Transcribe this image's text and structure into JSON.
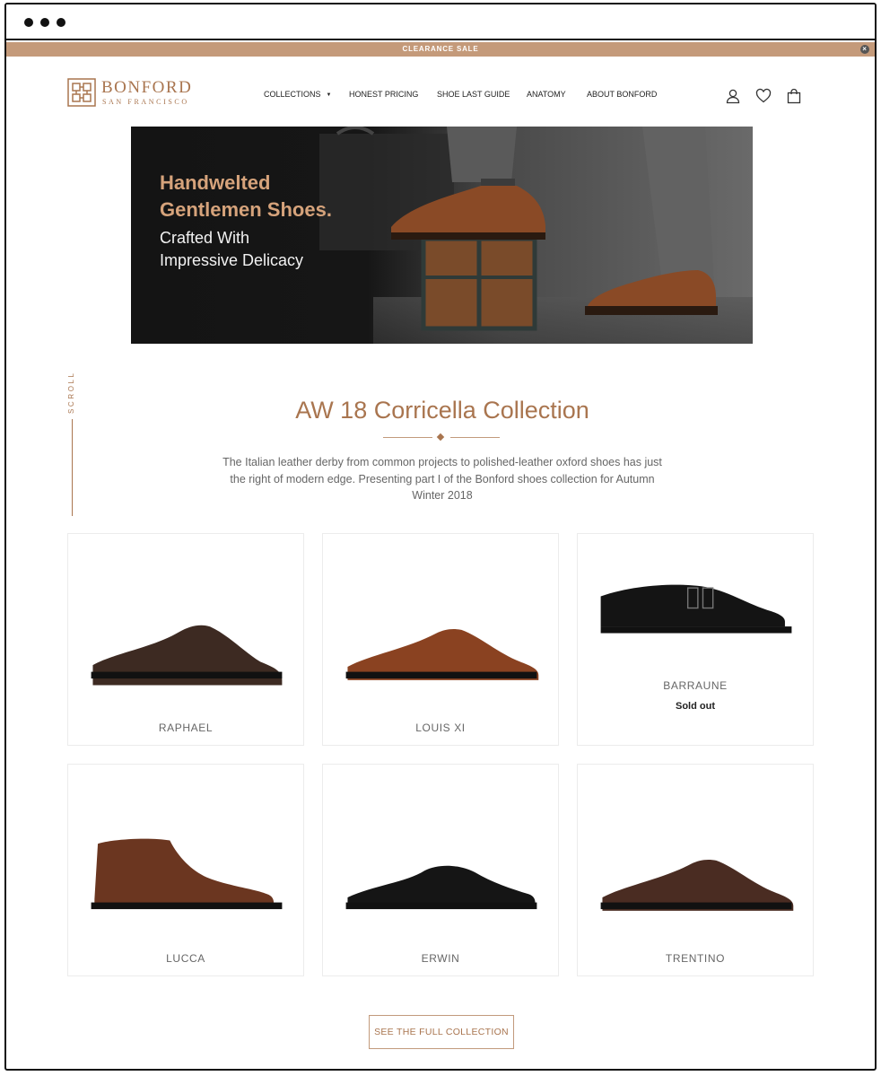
{
  "promo_bar": {
    "text": "CLEARANCE SALE",
    "close_icon": "close-icon"
  },
  "brand": {
    "name": "BONFORD",
    "subtitle": "SAN FRANCISCO",
    "accent_color": "#a9754f"
  },
  "nav": {
    "items": [
      {
        "label": "COLLECTIONS",
        "has_dropdown": true
      },
      {
        "label": "HONEST PRICING"
      },
      {
        "label": "SHOE LAST GUIDE"
      },
      {
        "label": "ANATOMY"
      },
      {
        "label": "ABOUT BONFORD"
      }
    ],
    "icons": [
      "user-icon",
      "heart-icon",
      "shopping-bag-icon"
    ]
  },
  "hero": {
    "headline_line1": "Handwelted",
    "headline_line2": "Gentlemen Shoes.",
    "sub_line1": "Crafted With",
    "sub_line2": "Impressive Delicacy"
  },
  "scroll_label": "SCROLL",
  "collection": {
    "title": "AW 18 Corricella Collection",
    "description": "The Italian leather derby from common projects to polished-leather oxford shoes has just the right of modern edge. Presenting part I of the Bonford shoes collection for Autumn Winter 2018",
    "products": [
      {
        "name": "RAPHAEL",
        "status": "",
        "color": "#3d2a22",
        "style": "brogue"
      },
      {
        "name": "LOUIS XI",
        "status": "",
        "color": "#8a4221",
        "style": "wholecut"
      },
      {
        "name": "BARRAUNE",
        "status": "Sold out",
        "color": "#141414",
        "style": "monk"
      },
      {
        "name": "LUCCA",
        "status": "",
        "color": "#6b3620",
        "style": "chukka"
      },
      {
        "name": "ERWIN",
        "status": "",
        "color": "#151515",
        "style": "loafer"
      },
      {
        "name": "TRENTINO",
        "status": "",
        "color": "#4a2c22",
        "style": "wholecut"
      }
    ],
    "cta_label": "SEE THE FULL COLLECTION"
  }
}
